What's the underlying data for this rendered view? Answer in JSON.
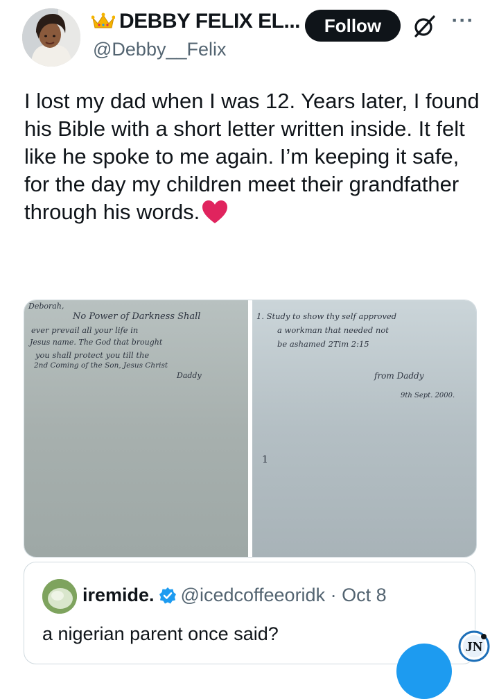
{
  "author": {
    "name": "DEBBY FELIX EL...",
    "handle": "@Debby__Felix",
    "follow_label": "Follow",
    "badge_icon": "crown-icon"
  },
  "post": {
    "text": "I lost my dad when I was 12. Years later, I found his Bible with a short letter written inside. It felt like he spoke to me again. I’m keeping it safe, for the day my children meet their grandfather through his words.",
    "emoji": "red-heart-icon"
  },
  "media": {
    "left_page": {
      "lines": [
        "Deborah,",
        "No Power of Darkness Shall",
        "ever prevail all your life in",
        "Jesus name. The God that brought",
        "you shall protect you till the",
        "2nd Coming of the Son, Jesus Christ",
        "Daddy"
      ]
    },
    "right_page": {
      "lines": [
        "1. Study to show thy self approved",
        "a workman that needed not",
        "be ashamed   2Tim 2:15",
        "from Daddy",
        "9th Sept. 2000.",
        "1"
      ]
    }
  },
  "quote": {
    "name": "iremide.",
    "handle_time": "@icedcoffeeoridk · Oct 8",
    "text": "a nigerian parent once said?"
  },
  "colors": {
    "follow_bg": "#0f1419",
    "verified": "#1d9bf0",
    "heart": "#e0245e",
    "secondary_text": "#536471"
  }
}
